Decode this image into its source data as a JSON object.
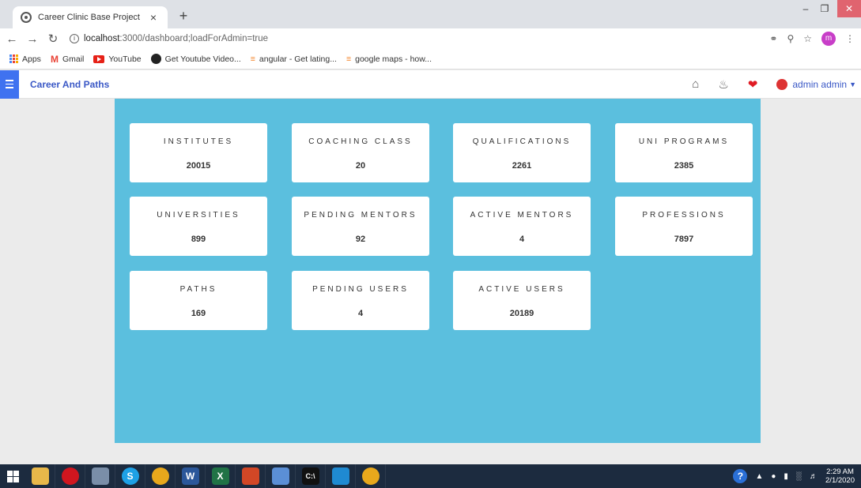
{
  "browser": {
    "tab_title": "Career Clinic Base Project",
    "tab_close": "×",
    "new_tab": "+",
    "url_host": "localhost",
    "url_path": ":3000/dashboard;loadForAdmin=true",
    "profile_initial": "m",
    "bookmarks": [
      {
        "label": "Apps",
        "icon": "apps-grid-icon"
      },
      {
        "label": "Gmail",
        "icon": "gmail-icon"
      },
      {
        "label": "YouTube",
        "icon": "youtube-icon"
      },
      {
        "label": "Get Youtube Video...",
        "icon": "github-icon"
      },
      {
        "label": "angular - Get lating...",
        "icon": "stackoverflow-icon"
      },
      {
        "label": "google maps - how...",
        "icon": "stackoverflow-icon"
      }
    ]
  },
  "app": {
    "brand": "Career And Paths",
    "user_name": "admin admin",
    "accent_color": "#3f72f0",
    "panel_color": "#5bbfde"
  },
  "cards": [
    {
      "label": "INSTITUTES",
      "value": "20015"
    },
    {
      "label": "COACHING CLASS",
      "value": "20"
    },
    {
      "label": "QUALIFICATIONS",
      "value": "2261"
    },
    {
      "label": "UNI PROGRAMS",
      "value": "2385"
    },
    {
      "label": "UNIVERSITIES",
      "value": "899"
    },
    {
      "label": "PENDING MENTORS",
      "value": "92"
    },
    {
      "label": "ACTIVE MENTORS",
      "value": "4"
    },
    {
      "label": "PROFESSIONS",
      "value": "7897"
    },
    {
      "label": "PATHS",
      "value": "169"
    },
    {
      "label": "PENDING USERS",
      "value": "4"
    },
    {
      "label": "ACTIVE USERS",
      "value": "20189"
    }
  ],
  "taskbar": {
    "time": "2:29 AM",
    "date": "2/1/2020"
  }
}
